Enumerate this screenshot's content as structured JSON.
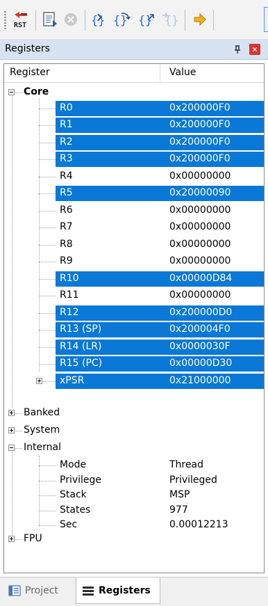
{
  "toolbar": {
    "buttons": [
      {
        "name": "reset-cpu-button",
        "label": "RST"
      },
      {
        "name": "run-button"
      },
      {
        "name": "stop-button"
      },
      {
        "name": "step-button",
        "label": "{}"
      },
      {
        "name": "step-over-button",
        "label": "{}"
      },
      {
        "name": "step-out-button",
        "label": "{}"
      },
      {
        "name": "run-to-cursor-button",
        "label": "{}"
      },
      {
        "name": "show-next-statement-button"
      }
    ]
  },
  "panel": {
    "title": "Registers"
  },
  "table": {
    "col_register": "Register",
    "col_value": "Value",
    "groups": {
      "core": "Core",
      "banked": "Banked",
      "system": "System",
      "internal": "Internal",
      "fpu": "FPU"
    },
    "core": [
      {
        "name": "R0",
        "value": "0x200000F0",
        "selected": true
      },
      {
        "name": "R1",
        "value": "0x200000F0",
        "selected": true
      },
      {
        "name": "R2",
        "value": "0x200000F0",
        "selected": true
      },
      {
        "name": "R3",
        "value": "0x200000F0",
        "selected": true
      },
      {
        "name": "R4",
        "value": "0x00000000",
        "selected": false
      },
      {
        "name": "R5",
        "value": "0x20000090",
        "selected": true
      },
      {
        "name": "R6",
        "value": "0x00000000",
        "selected": false
      },
      {
        "name": "R7",
        "value": "0x00000000",
        "selected": false
      },
      {
        "name": "R8",
        "value": "0x00000000",
        "selected": false
      },
      {
        "name": "R9",
        "value": "0x00000000",
        "selected": false
      },
      {
        "name": "R10",
        "value": "0x00000D84",
        "selected": true
      },
      {
        "name": "R11",
        "value": "0x00000000",
        "selected": false
      },
      {
        "name": "R12",
        "value": "0x200000D0",
        "selected": true
      },
      {
        "name": "R13 (SP)",
        "value": "0x200004F0",
        "selected": true
      },
      {
        "name": "R14 (LR)",
        "value": "0x0000030F",
        "selected": true
      },
      {
        "name": "R15 (PC)",
        "value": "0x00000D30",
        "selected": true
      },
      {
        "name": "xPSR",
        "value": "0x21000000",
        "selected": true
      }
    ],
    "internal": [
      {
        "name": "Mode",
        "value": "Thread"
      },
      {
        "name": "Privilege",
        "value": "Privileged"
      },
      {
        "name": "Stack",
        "value": "MSP"
      },
      {
        "name": "States",
        "value": "977"
      },
      {
        "name": "Sec",
        "value": "0.00012213"
      }
    ]
  },
  "tabs": {
    "project": "Project",
    "registers": "Registers"
  },
  "colors": {
    "selection": "#0a78d7",
    "title_bar": "#d7e3f3",
    "close": "#d9352f"
  }
}
